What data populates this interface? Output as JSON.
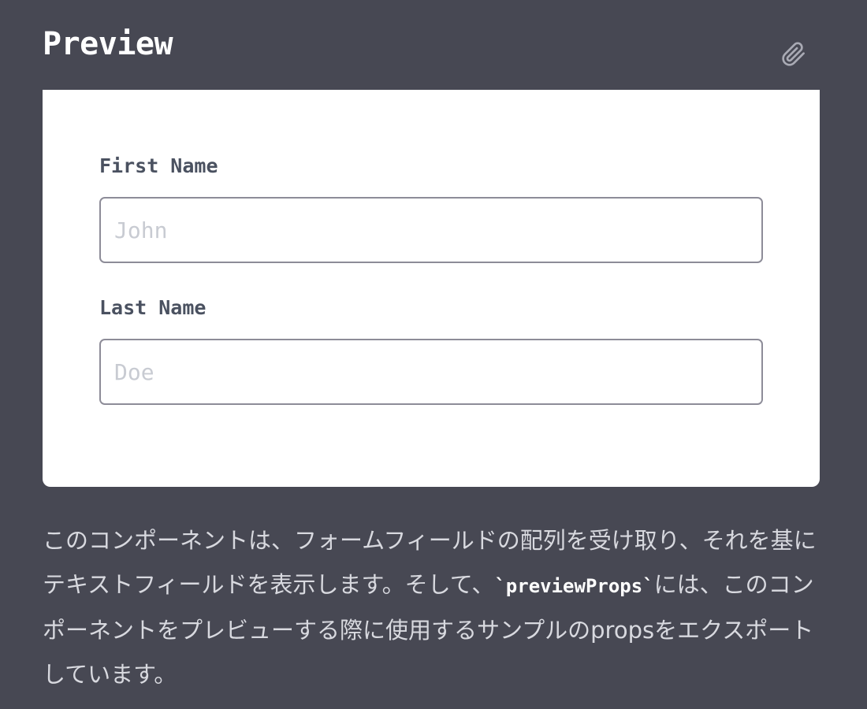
{
  "header": {
    "title": "Preview",
    "attach_icon": "paperclip-icon"
  },
  "form": {
    "first_name": {
      "label": "First Name",
      "placeholder": "John",
      "value": ""
    },
    "last_name": {
      "label": "Last Name",
      "placeholder": "Doe",
      "value": ""
    }
  },
  "description": {
    "part1": "このコンポーネントは、フォームフィールドの配列を受け取り、それを基にテキストフィールドを表示します。そして、",
    "code": "`previewProps`",
    "part2": "には、このコンポーネントをプレビューする際に使用するサンプルのpropsをエクスポートしています。"
  },
  "colors": {
    "background": "#474853",
    "card": "#ffffff",
    "label": "#4a5160",
    "input_border": "#8d8c98",
    "placeholder": "#c8cbd2",
    "body_text": "#d8d9df"
  }
}
